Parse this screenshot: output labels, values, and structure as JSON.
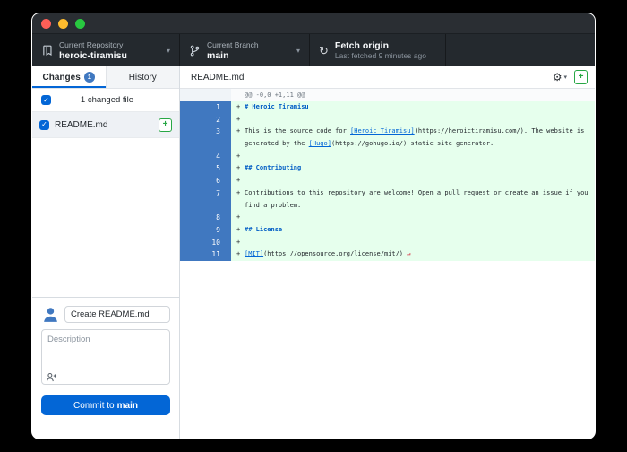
{
  "icons": {
    "chevron_down": "▾",
    "gear": "⚙",
    "sync": "↻",
    "check": "✓",
    "plus": "+",
    "no_newline": "↵"
  },
  "colors": {
    "toolbar_bg": "#24292e",
    "accent_blue": "#0366d6",
    "gutter_selected_blue": "#4078c0",
    "added_line_bg": "#e6ffed",
    "added_status_green": "#28a745",
    "no_newline_red": "#d73a49",
    "traffic_red": "#ff5f57",
    "traffic_yellow": "#febc2e",
    "traffic_green": "#28c840"
  },
  "toolbar": {
    "repository": {
      "label": "Current Repository",
      "value": "heroic-tiramisu"
    },
    "branch": {
      "label": "Current Branch",
      "value": "main"
    },
    "fetch": {
      "title": "Fetch origin",
      "subtitle": "Last fetched 9 minutes ago"
    }
  },
  "sidebar": {
    "tabs": [
      {
        "label": "Changes",
        "badge": "1"
      },
      {
        "label": "History"
      }
    ],
    "changed_files_summary": "1 changed file",
    "files": [
      {
        "name": "README.md",
        "status": "added",
        "checked": true
      }
    ],
    "commit": {
      "summary_value": "Create README.md",
      "description_placeholder": "Description",
      "button_prefix": "Commit to",
      "button_branch": "main"
    }
  },
  "main": {
    "tab": "README.md",
    "diff": {
      "hunk_header": "@@ -0,0 +1,11 @@",
      "rows": [
        {
          "kind": "hunk",
          "num": "",
          "prefix": "",
          "segments": [
            [
              "hunk",
              "@@ -0,0 +1,11 @@"
            ]
          ]
        },
        {
          "kind": "add",
          "num": "1",
          "prefix": "+",
          "segments": [
            [
              "header",
              "# Heroic Tiramisu"
            ]
          ]
        },
        {
          "kind": "add",
          "num": "2",
          "prefix": "+",
          "segments": []
        },
        {
          "kind": "add",
          "num": "3",
          "prefix": "+",
          "segments": [
            [
              "plain",
              "This is the source code for "
            ],
            [
              "link",
              "[Heroic Tiramisu]"
            ],
            [
              "plain",
              "(https://heroictiramisu.com/). The website is"
            ]
          ]
        },
        {
          "kind": "add wrap",
          "num": "",
          "prefix": "",
          "segments": [
            [
              "plain",
              "generated by the "
            ],
            [
              "link",
              "[Hugo]"
            ],
            [
              "plain",
              "(https://gohugo.io/) static site generator."
            ]
          ]
        },
        {
          "kind": "add",
          "num": "4",
          "prefix": "+",
          "segments": []
        },
        {
          "kind": "add",
          "num": "5",
          "prefix": "+",
          "segments": [
            [
              "header",
              "## Contributing"
            ]
          ]
        },
        {
          "kind": "add",
          "num": "6",
          "prefix": "+",
          "segments": []
        },
        {
          "kind": "add",
          "num": "7",
          "prefix": "+",
          "segments": [
            [
              "plain",
              "Contributions to this repository are welcome! Open a pull request or create an issue if you"
            ]
          ]
        },
        {
          "kind": "add wrap",
          "num": "",
          "prefix": "",
          "segments": [
            [
              "plain",
              "find a problem."
            ]
          ]
        },
        {
          "kind": "add",
          "num": "8",
          "prefix": "+",
          "segments": []
        },
        {
          "kind": "add",
          "num": "9",
          "prefix": "+",
          "segments": [
            [
              "header",
              "## License"
            ]
          ]
        },
        {
          "kind": "add",
          "num": "10",
          "prefix": "+",
          "segments": []
        },
        {
          "kind": "add",
          "num": "11",
          "prefix": "+",
          "segments": [
            [
              "link",
              "[MIT]"
            ],
            [
              "plain",
              "(https://opensource.org/license/mit/) "
            ],
            [
              "nonewline",
              "↵"
            ]
          ]
        }
      ]
    }
  }
}
